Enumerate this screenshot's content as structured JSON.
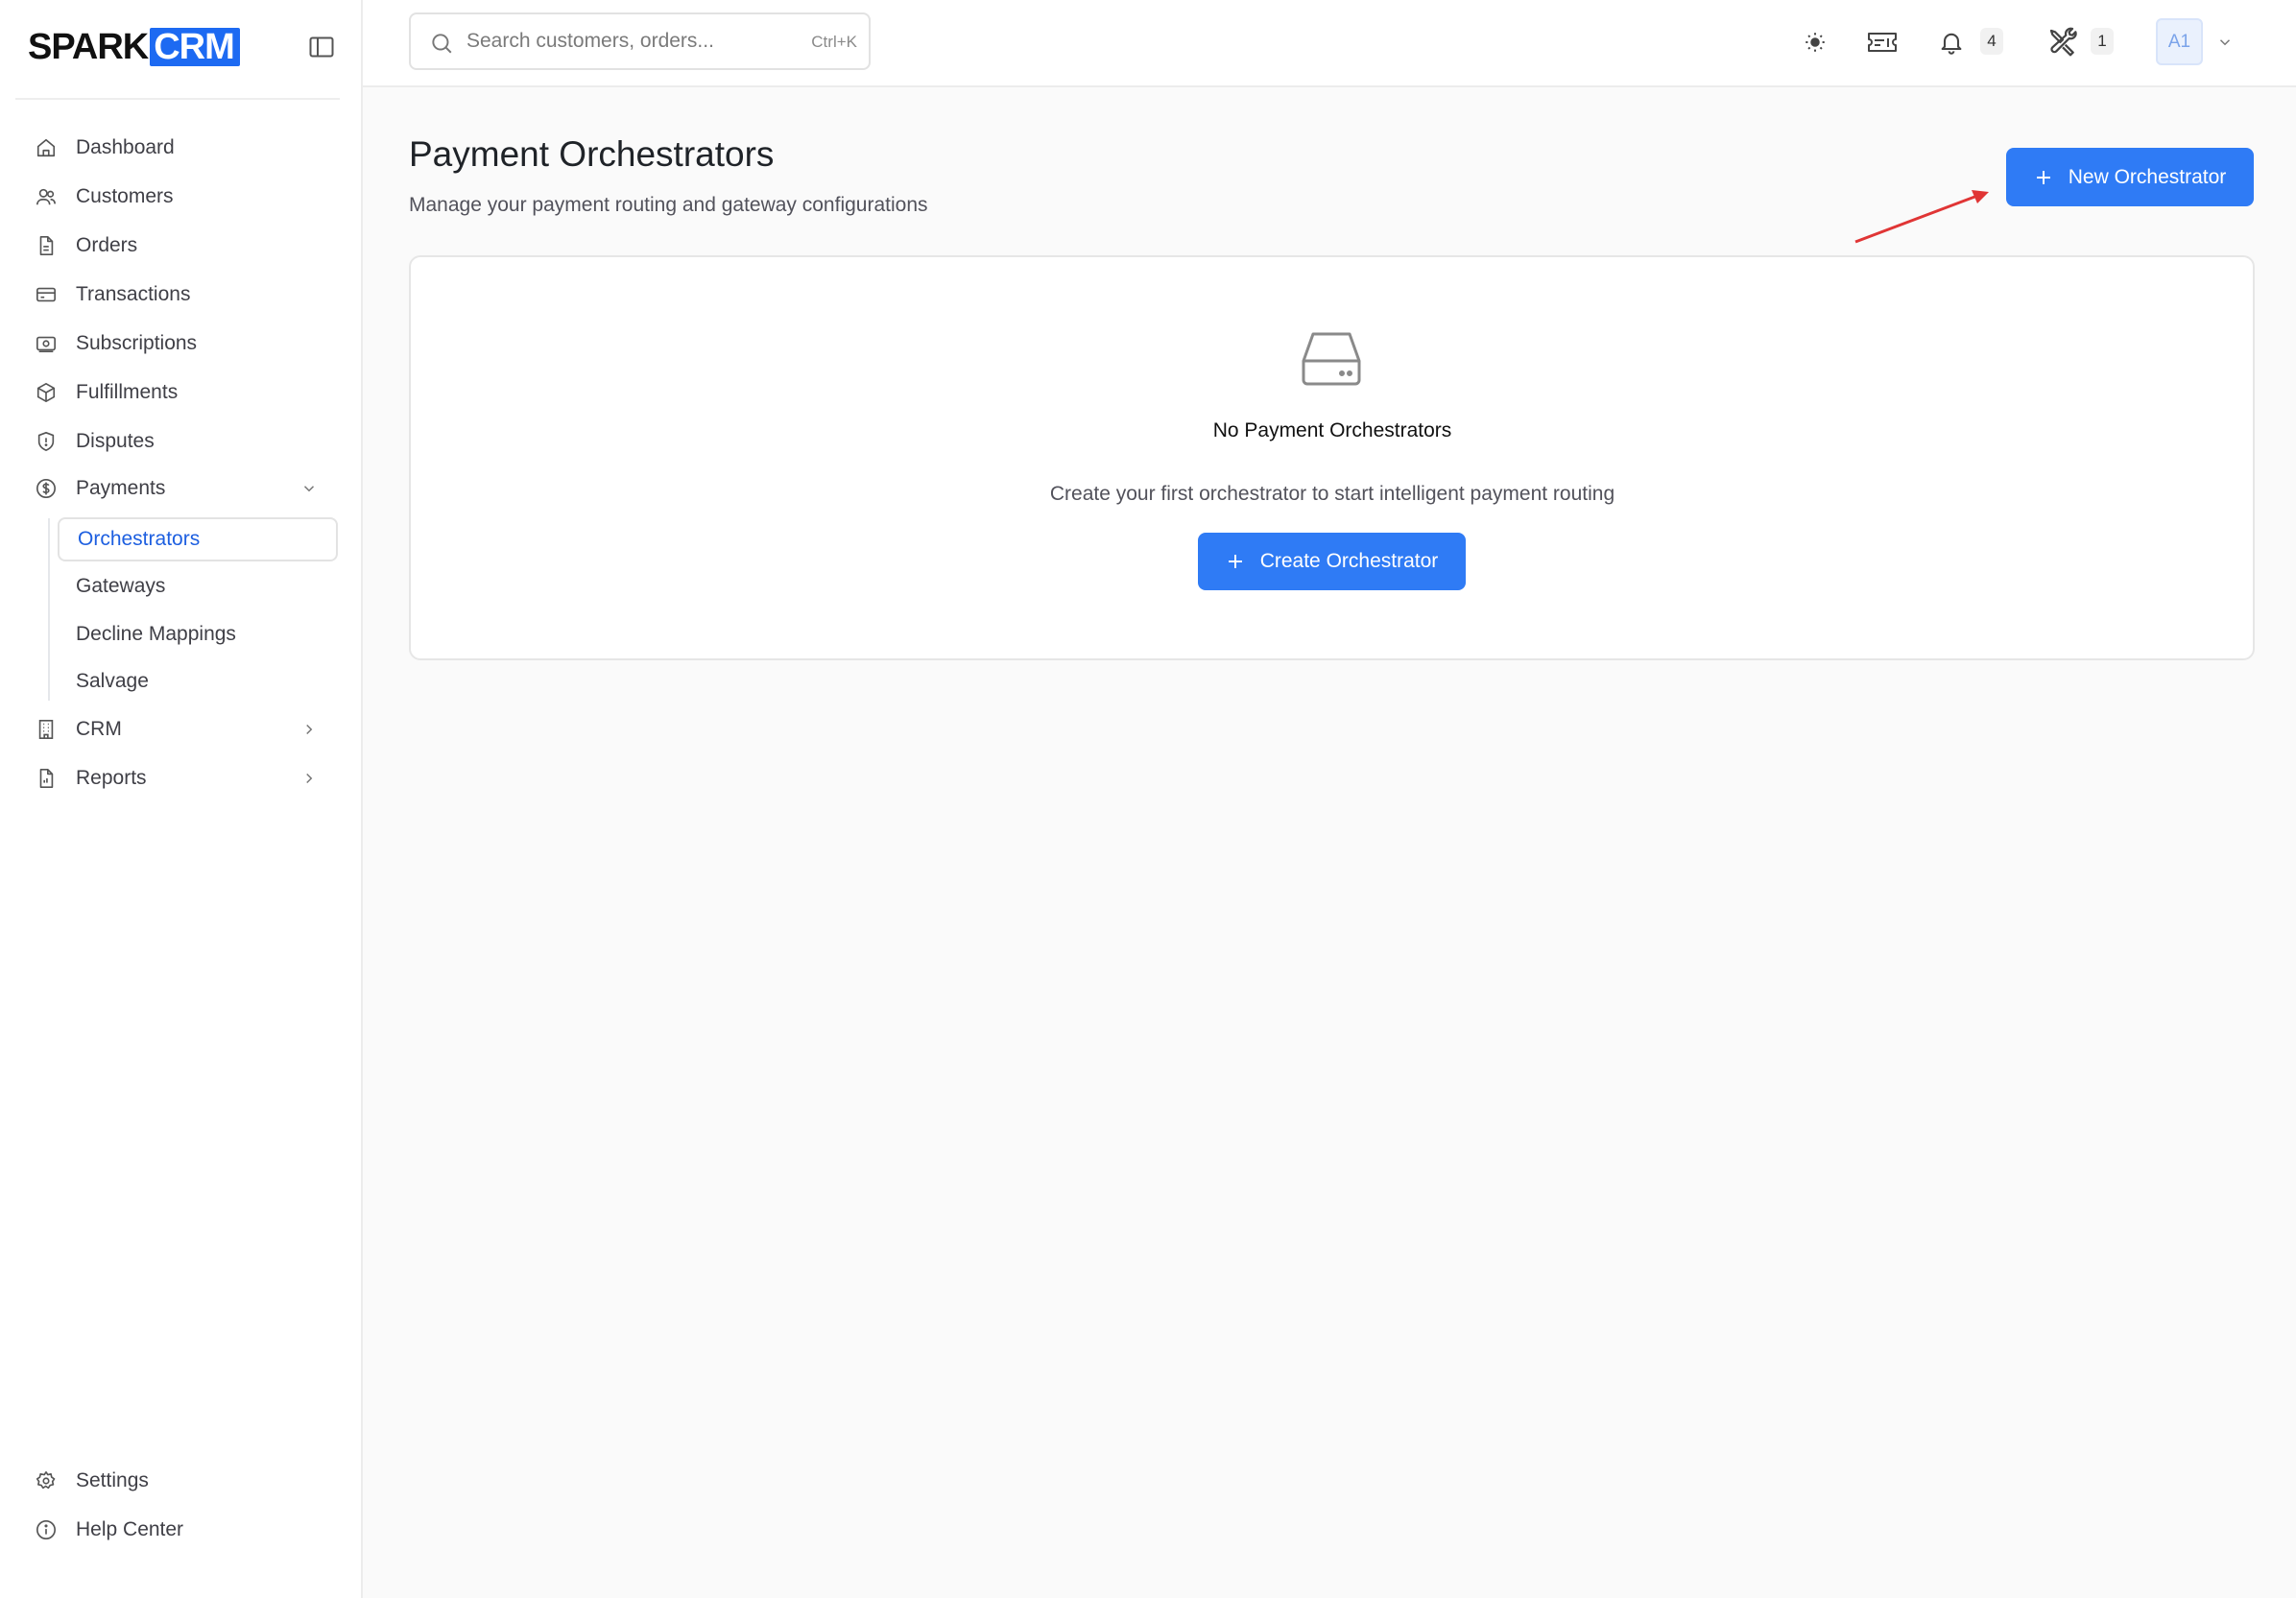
{
  "brand": {
    "part1": "SPARK",
    "part2": "CRM",
    "accent": "#1d6af2"
  },
  "sidebar": {
    "items": [
      {
        "label": "Dashboard",
        "icon": "home-icon"
      },
      {
        "label": "Customers",
        "icon": "users-icon"
      },
      {
        "label": "Orders",
        "icon": "file-icon"
      },
      {
        "label": "Transactions",
        "icon": "credit-card-icon"
      },
      {
        "label": "Subscriptions",
        "icon": "banknote-icon"
      },
      {
        "label": "Fulfillments",
        "icon": "package-icon"
      },
      {
        "label": "Disputes",
        "icon": "shield-icon"
      },
      {
        "label": "Payments",
        "icon": "dollar-circle-icon"
      }
    ],
    "payments_sub": [
      "Orchestrators",
      "Gateways",
      "Decline Mappings",
      "Salvage"
    ],
    "crm_label": "CRM",
    "reports_label": "Reports",
    "settings_label": "Settings",
    "help_label": "Help Center"
  },
  "topbar": {
    "search_placeholder": "Search customers, orders...",
    "search_shortcut": "Ctrl+K",
    "notifications_count": "4",
    "tools_count": "1",
    "avatar_initials": "A1"
  },
  "main": {
    "title": "Payment Orchestrators",
    "subtitle": "Manage your payment routing and gateway configurations",
    "new_button": "New Orchestrator",
    "empty_title": "No Payment Orchestrators",
    "empty_desc": "Create your first orchestrator to start intelligent payment routing",
    "create_button": "Create Orchestrator"
  }
}
